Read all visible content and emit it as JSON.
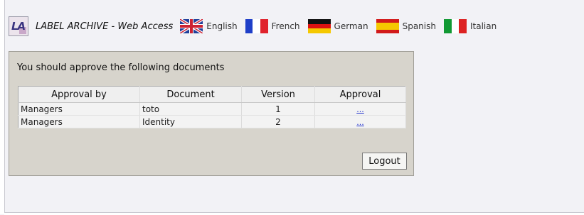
{
  "header": {
    "logo_text": "LA",
    "title": "LABEL ARCHIVE - Web Access",
    "languages": [
      {
        "label": "English",
        "flag": "uk-flag-icon"
      },
      {
        "label": "French",
        "flag": "france-flag-icon"
      },
      {
        "label": "German",
        "flag": "germany-flag-icon"
      },
      {
        "label": "Spanish",
        "flag": "spain-flag-icon"
      },
      {
        "label": "Italian",
        "flag": "italy-flag-icon"
      }
    ]
  },
  "panel": {
    "title": "You should approve the following documents",
    "columns": [
      "Approval by",
      "Document",
      "Version",
      "Approval"
    ],
    "rows": [
      {
        "approval_by": "Managers",
        "document": "toto",
        "version": "1",
        "approval_link": "..."
      },
      {
        "approval_by": "Managers",
        "document": "Identity",
        "version": "2",
        "approval_link": "..."
      }
    ],
    "logout_label": "Logout"
  },
  "colors": {
    "panel_bg": "#d7d4cc",
    "page_bg": "#f2f2f6",
    "link": "#2233cc"
  }
}
